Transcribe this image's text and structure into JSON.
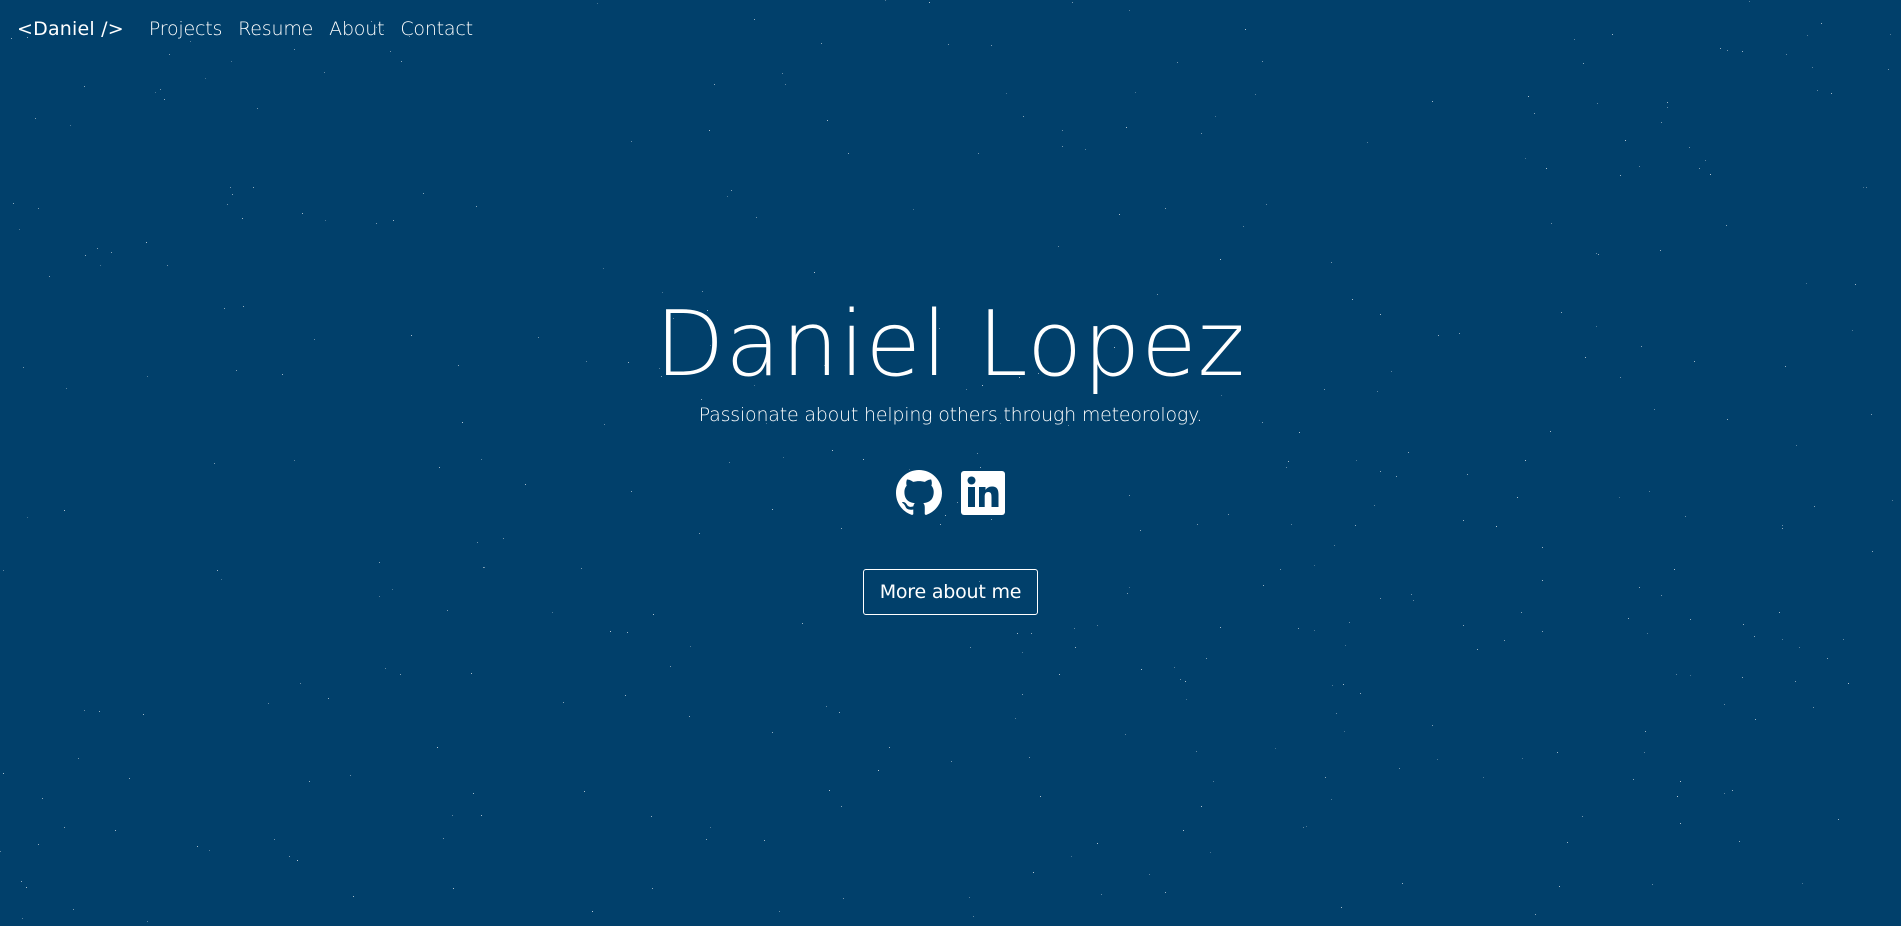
{
  "colors": {
    "background": "#01406b",
    "text": "#ffffff"
  },
  "nav": {
    "brand": "<Daniel />",
    "links": [
      "Projects",
      "Resume",
      "About",
      "Contact"
    ]
  },
  "hero": {
    "name": "Daniel Lopez",
    "tagline": "Passionate about helping others through meteorology.",
    "socials": [
      {
        "icon": "github-icon"
      },
      {
        "icon": "linkedin-icon"
      }
    ],
    "cta_label": "More about me"
  }
}
